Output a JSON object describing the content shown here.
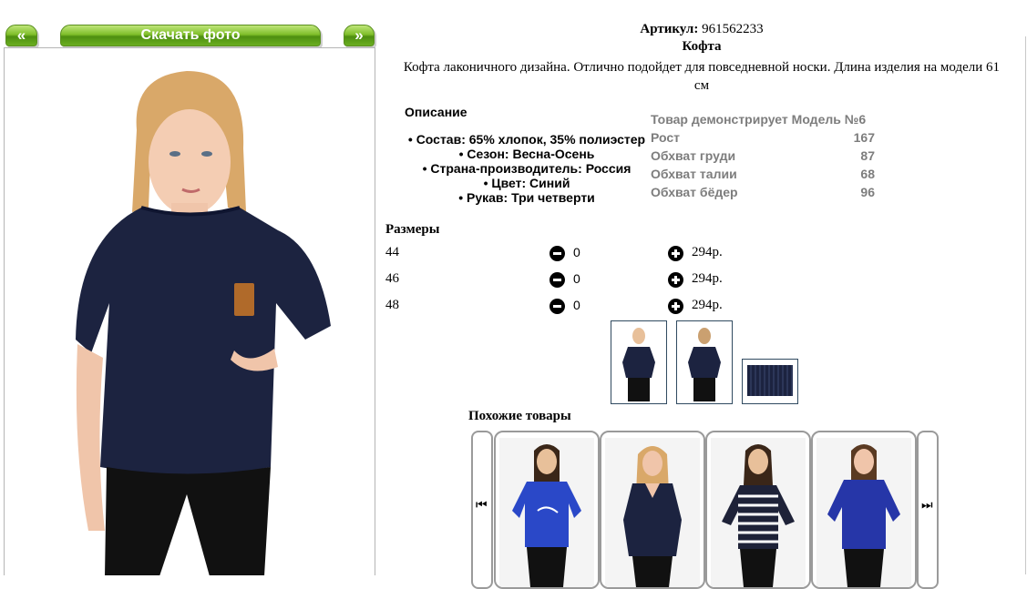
{
  "nav": {
    "prev_label": "«",
    "download_label": "Скачать фото",
    "next_label": "»"
  },
  "product": {
    "article_label": "Артикул:",
    "article_value": "961562233",
    "name": "Кофта",
    "description_line1": "Кофта лаконичного дизайна. Отлично подойдет для повседневной носки. Длина изделия на модели 61",
    "description_line2": "см"
  },
  "description": {
    "heading": "Описание",
    "items": [
      "Состав: 65% хлопок, 35% полиэстер",
      "Сезон: Весна-Осень",
      "Страна-производитель: Россия",
      "Цвет: Синий",
      "Рукав: Три четверти"
    ]
  },
  "model": {
    "title": "Товар демонстрирует Модель №6",
    "params": [
      {
        "label": "Рост",
        "value": "167"
      },
      {
        "label": "Обхват груди",
        "value": "87"
      },
      {
        "label": "Обхват талии",
        "value": "68"
      },
      {
        "label": "Обхват бёдер",
        "value": "96"
      }
    ]
  },
  "sizes": {
    "heading": "Размеры",
    "rows": [
      {
        "size": "44",
        "qty": "0",
        "price": "294р."
      },
      {
        "size": "46",
        "qty": "0",
        "price": "294р."
      },
      {
        "size": "48",
        "qty": "0",
        "price": "294р."
      }
    ]
  },
  "similar": {
    "heading": "Похожие товары",
    "prev_icon": "first-page-icon",
    "next_icon": "last-page-icon"
  },
  "colors": {
    "green": "#6aae20",
    "navy": "#1c2340",
    "royal": "#2a48c8"
  }
}
